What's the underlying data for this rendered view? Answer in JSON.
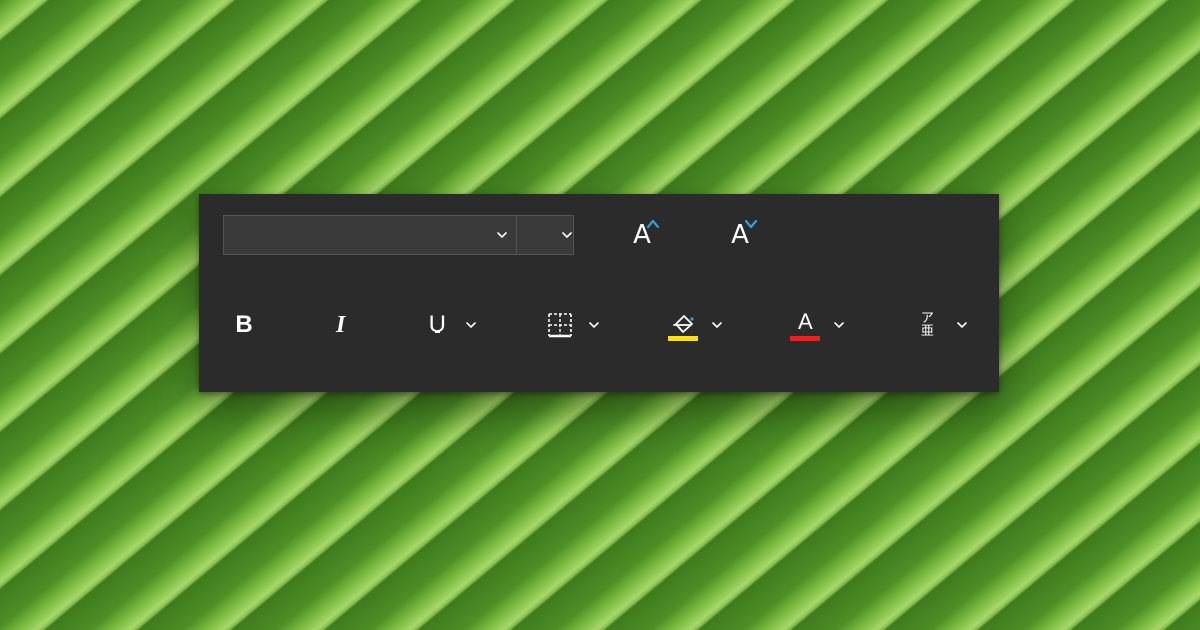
{
  "colors": {
    "panel_bg": "#2b2b2b",
    "combo_bg": "#3a3a3a",
    "combo_border": "#555555",
    "accent_blue": "#2f9fe0",
    "highlight_swatch": "#ffe100",
    "fontcolor_swatch": "#ff1a1a"
  },
  "font_group": {
    "font_name": {
      "value": "",
      "placeholder": ""
    },
    "font_size": {
      "value": "",
      "placeholder": ""
    },
    "grow_font_label": "A",
    "shrink_font_label": "A"
  },
  "format_group": {
    "bold_label": "B",
    "italic_label": "I",
    "underline_label": "U",
    "phonetic_top": "ア",
    "phonetic_bottom": "亜"
  }
}
